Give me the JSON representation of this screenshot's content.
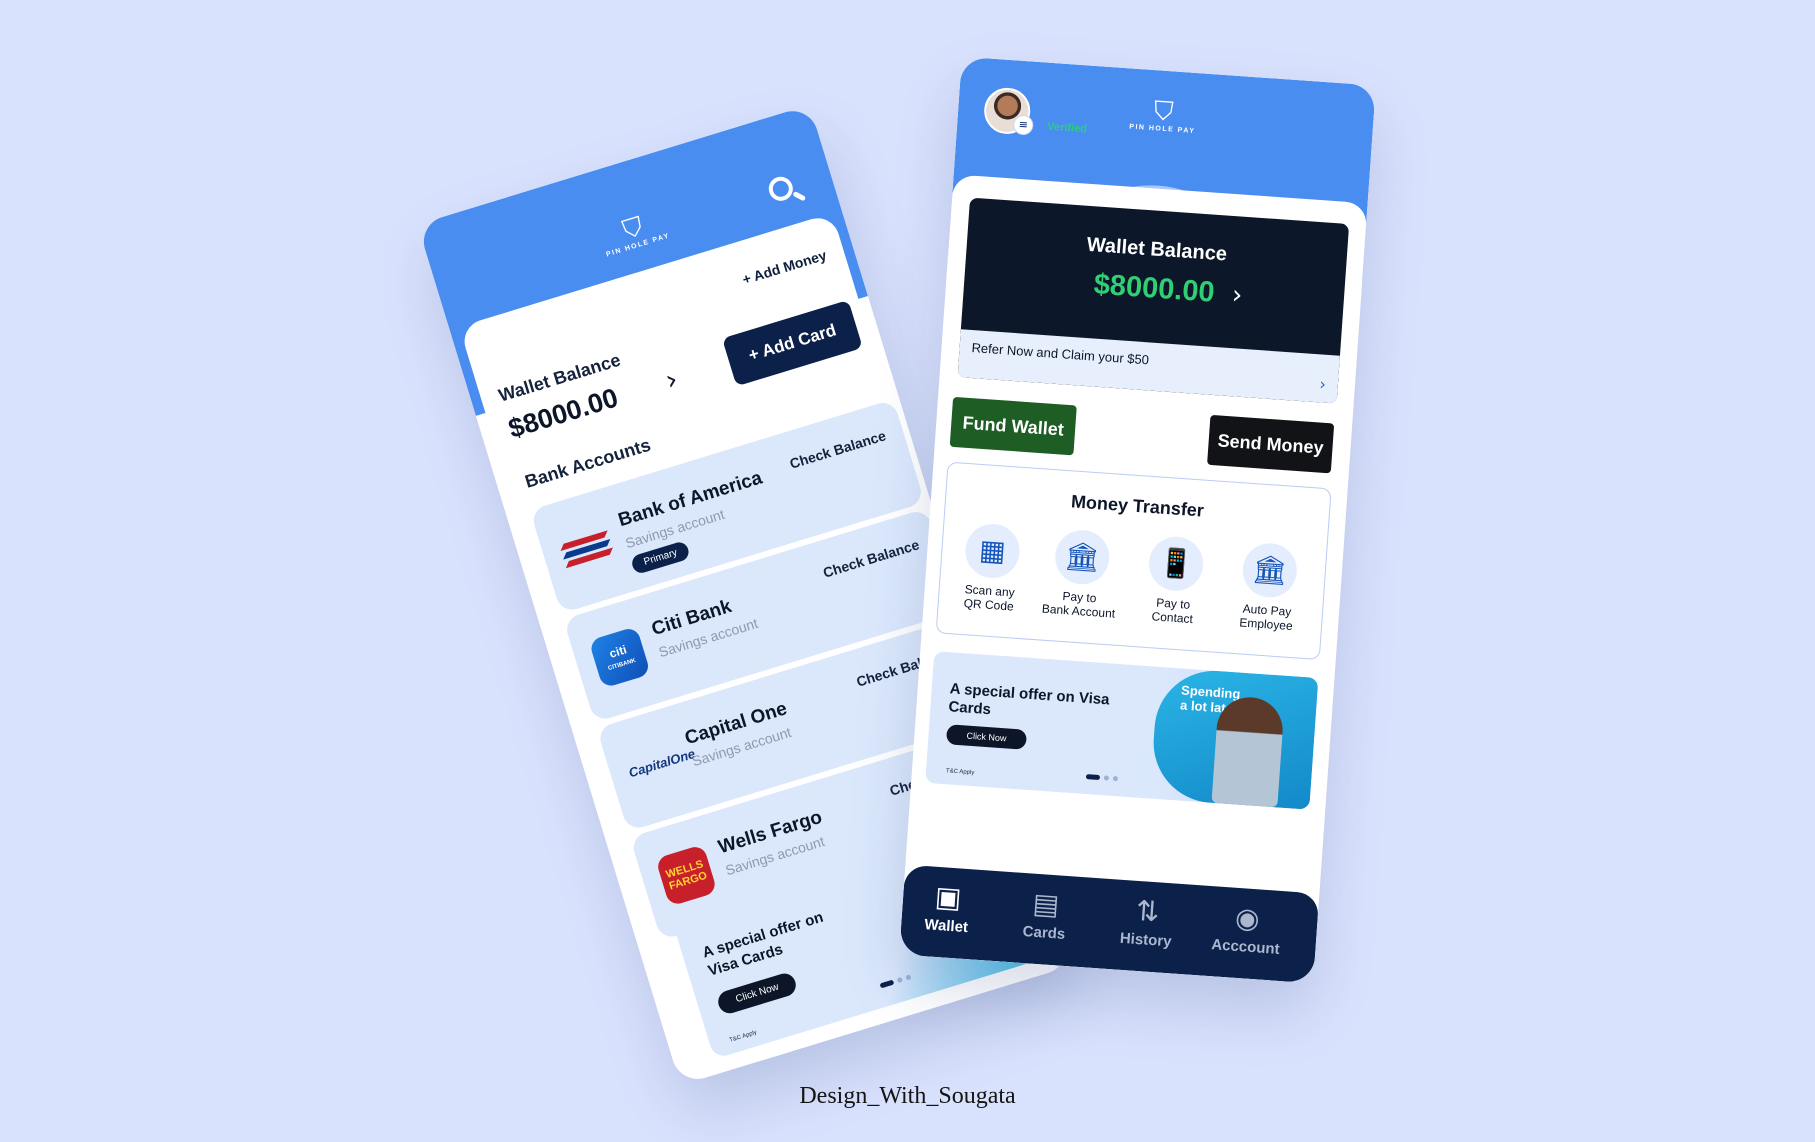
{
  "colors": {
    "background": "#d9e2fd",
    "header_blue": "#4a8df0",
    "navy": "#0b2149",
    "balance_green": "#2fcf74",
    "fund_green": "#1e5d23",
    "verified_green": "#27d07a"
  },
  "left_phone": {
    "header": {
      "avatar_icon": "menu-icon",
      "logo_icon": "shield-icon",
      "logo_text": "PIN HOLE PAY",
      "search_icon": "search-icon"
    },
    "add_money_label": "+ Add Money",
    "wallet_balance_label": "Wallet Balance",
    "wallet_balance_amount": "$8000.00",
    "add_card_label": "+ Add  Card",
    "bank_accounts_heading": "Bank Accounts",
    "banks": [
      {
        "name": "Bank of America",
        "type": "Savings account",
        "check_label": "Check Balance",
        "badge": "Primary",
        "logo": "bank-of-america-logo"
      },
      {
        "name": "Citi Bank",
        "type": "Savings account",
        "check_label": "Check Balance",
        "logo": "citi-bank-logo",
        "logo_text": "citi",
        "logo_subtext": "CITIBANK"
      },
      {
        "name": "Capital One",
        "type": "Savings account",
        "check_label": "Check Balance",
        "logo": "capital-one-logo",
        "logo_text": "CapitalOne"
      },
      {
        "name": "Wells Fargo",
        "type": "Savings account",
        "check_label": "Check Balance",
        "logo": "wells-fargo-logo",
        "logo_text": "WELLS FARGO"
      }
    ],
    "promo": {
      "title": "A special offer on Visa Cards",
      "button": "Click Now",
      "tnc": "T&C Apply",
      "dots": 3,
      "active_dot": 0
    }
  },
  "right_phone": {
    "header": {
      "avatar_icon": "menu-icon",
      "verified_label": "Verified",
      "logo_icon": "shield-icon",
      "logo_text": "PIN HOLE PAY"
    },
    "balance_card": {
      "label": "Wallet Balance",
      "amount": "$8000.00",
      "refer_text": "Refer Now and Claim your $50"
    },
    "fund_wallet_label": "Fund Wallet",
    "send_money_label": "Send Money",
    "money_transfer": {
      "title": "Money Transfer",
      "items": [
        {
          "label_line1": "Scan any",
          "label_line2": "QR Code",
          "icon": "qr-code-icon"
        },
        {
          "label_line1": "Pay to",
          "label_line2": "Bank Account",
          "icon": "bank-icon"
        },
        {
          "label_line1": "Pay to",
          "label_line2": "Contact",
          "icon": "phone-icon"
        },
        {
          "label_line1": "Auto Pay",
          "label_line2": "Employee",
          "icon": "bank-icon"
        }
      ]
    },
    "promo": {
      "title": "A special offer on Visa Cards",
      "button": "Click Now",
      "tag_line1": "Spending",
      "tag_line2": "a lot lately?",
      "tnc": "T&C Apply",
      "dots": 3,
      "active_dot": 0
    },
    "bottom_nav": [
      {
        "label": "Wallet",
        "icon": "wallet-icon",
        "active": true
      },
      {
        "label": "Cards",
        "icon": "cards-icon",
        "active": false
      },
      {
        "label": "History",
        "icon": "history-icon",
        "active": false
      },
      {
        "label": "Acccount",
        "icon": "account-icon",
        "active": false
      }
    ]
  },
  "footer_credit": "Design_With_Sougata"
}
